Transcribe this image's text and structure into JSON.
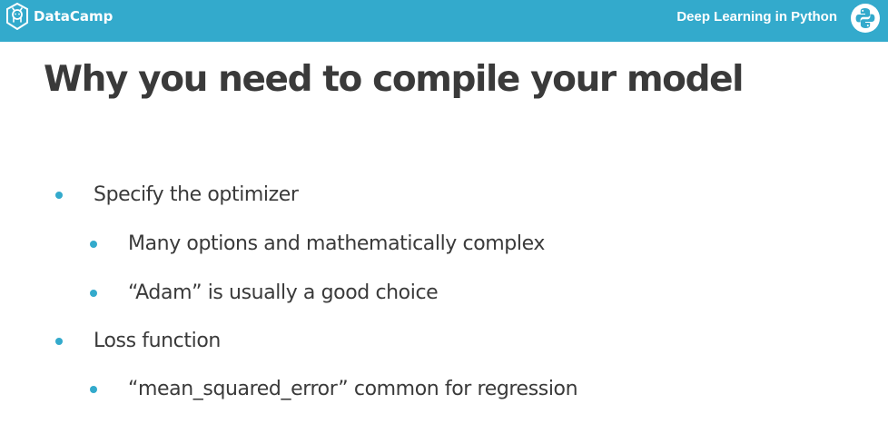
{
  "header": {
    "logo_text": "DataCamp",
    "logo_icon": "datacamp-logo-icon",
    "course_title": "Deep Learning in Python",
    "course_icon": "python-logo-icon",
    "colors": {
      "header_bg": "#33aacc",
      "title_text": "#3a3a3a",
      "bullet_dot": "#33aacc"
    }
  },
  "slide": {
    "title": "Why you need to compile your model",
    "bullets": [
      {
        "level": 1,
        "text": "Specify the optimizer"
      },
      {
        "level": 2,
        "text": "Many options and mathematically complex"
      },
      {
        "level": 2,
        "text": "“Adam” is usually a good choice"
      },
      {
        "level": 1,
        "text": "Loss function"
      },
      {
        "level": 2,
        "text": "“mean_squared_error” common for regression"
      }
    ]
  }
}
